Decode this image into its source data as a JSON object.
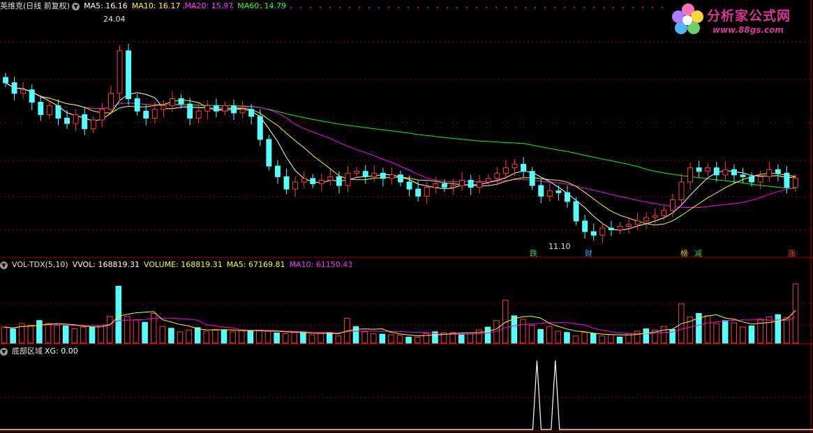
{
  "main_header": {
    "title": "英维克(日线 前复权)",
    "ma5": "MA5: 16.16",
    "ma10": "MA10: 16.17",
    "ma20": "MA20: 15.97",
    "ma60": "MA60: 14.79"
  },
  "vol_header": {
    "title": "VOL-TDX(5,10)",
    "vvol": "VVOL: 168819.31",
    "volume": "VOLUME: 168819.31",
    "ma5": "MA5: 67169.81",
    "ma10": "MA10: 61150.43"
  },
  "ind_header": {
    "title": "底部区域",
    "xg": "XG: 0.00"
  },
  "annotations": {
    "high_price": "24.04",
    "low_price": "11.10"
  },
  "event_tags": [
    {
      "text": "跌",
      "color": "#44cc44"
    },
    {
      "text": "财",
      "color": "#3aa0ff"
    },
    {
      "text": "榜",
      "color": "#e8c000"
    },
    {
      "text": "减",
      "color": "#44cc44"
    },
    {
      "text": "涨",
      "color": "#ff4444"
    }
  ],
  "logo": {
    "name": "分析家公式网",
    "url": "www.88gs.com"
  },
  "colors": {
    "up": "#ff3c3c",
    "down": "#54ffff",
    "ma5": "#ffffff",
    "ma10": "#ffff00",
    "ma20": "#ff00ff",
    "ma60": "#00ff00",
    "grid": "#8b0000"
  },
  "chart_data": {
    "type": "candlestick",
    "price_range": [
      11.1,
      24.04
    ],
    "close_approx": [
      20.2,
      19.6,
      19.8,
      19.1,
      18.4,
      18.9,
      18.2,
      17.9,
      18.4,
      17.6,
      18.1,
      18.7,
      19.6,
      22.0,
      19.3,
      18.6,
      18.2,
      18.7,
      18.9,
      19.3,
      19.0,
      18.2,
      18.6,
      18.9,
      18.6,
      18.9,
      18.5,
      18.7,
      18.3,
      17.0,
      15.5,
      14.9,
      14.2,
      14.6,
      14.8,
      14.5,
      14.7,
      14.9,
      14.4,
      15.1,
      15.2,
      14.9,
      15.1,
      14.8,
      15.0,
      14.6,
      14.2,
      13.8,
      14.3,
      14.5,
      14.3,
      14.4,
      14.7,
      14.3,
      14.6,
      14.8,
      15.1,
      15.4,
      15.6,
      15.2,
      14.4,
      13.8,
      14.1,
      14.0,
      13.5,
      12.4,
      11.8,
      11.6,
      12.0,
      11.9,
      12.1,
      12.2,
      12.4,
      12.6,
      12.7,
      13.0,
      13.6,
      14.6,
      15.4,
      15.2,
      15.4,
      15.0,
      15.3,
      15.0,
      14.9,
      14.6,
      14.9,
      15.3,
      15.1,
      14.3,
      14.8
    ]
  },
  "vol_data": {
    "volumes": [
      0.27,
      0.24,
      0.33,
      0.3,
      0.38,
      0.33,
      0.3,
      0.29,
      0.24,
      0.27,
      0.27,
      0.3,
      0.45,
      0.96,
      0.45,
      0.39,
      0.35,
      0.5,
      0.28,
      0.25,
      0.19,
      0.22,
      0.26,
      0.2,
      0.23,
      0.22,
      0.19,
      0.21,
      0.2,
      0.22,
      0.2,
      0.17,
      0.16,
      0.18,
      0.18,
      0.14,
      0.16,
      0.18,
      0.12,
      0.42,
      0.28,
      0.19,
      0.16,
      0.15,
      0.14,
      0.13,
      0.1,
      0.1,
      0.16,
      0.19,
      0.17,
      0.18,
      0.15,
      0.17,
      0.22,
      0.27,
      0.38,
      0.72,
      0.46,
      0.4,
      0.3,
      0.23,
      0.28,
      0.2,
      0.18,
      0.12,
      0.18,
      0.16,
      0.12,
      0.14,
      0.1,
      0.16,
      0.2,
      0.24,
      0.22,
      0.28,
      0.23,
      0.66,
      0.44,
      0.5,
      0.46,
      0.33,
      0.38,
      0.34,
      0.27,
      0.29,
      0.39,
      0.44,
      0.48,
      0.43,
      1.0
    ]
  },
  "xg_data": {
    "spikes_at": [
      0.672,
      0.695
    ]
  }
}
